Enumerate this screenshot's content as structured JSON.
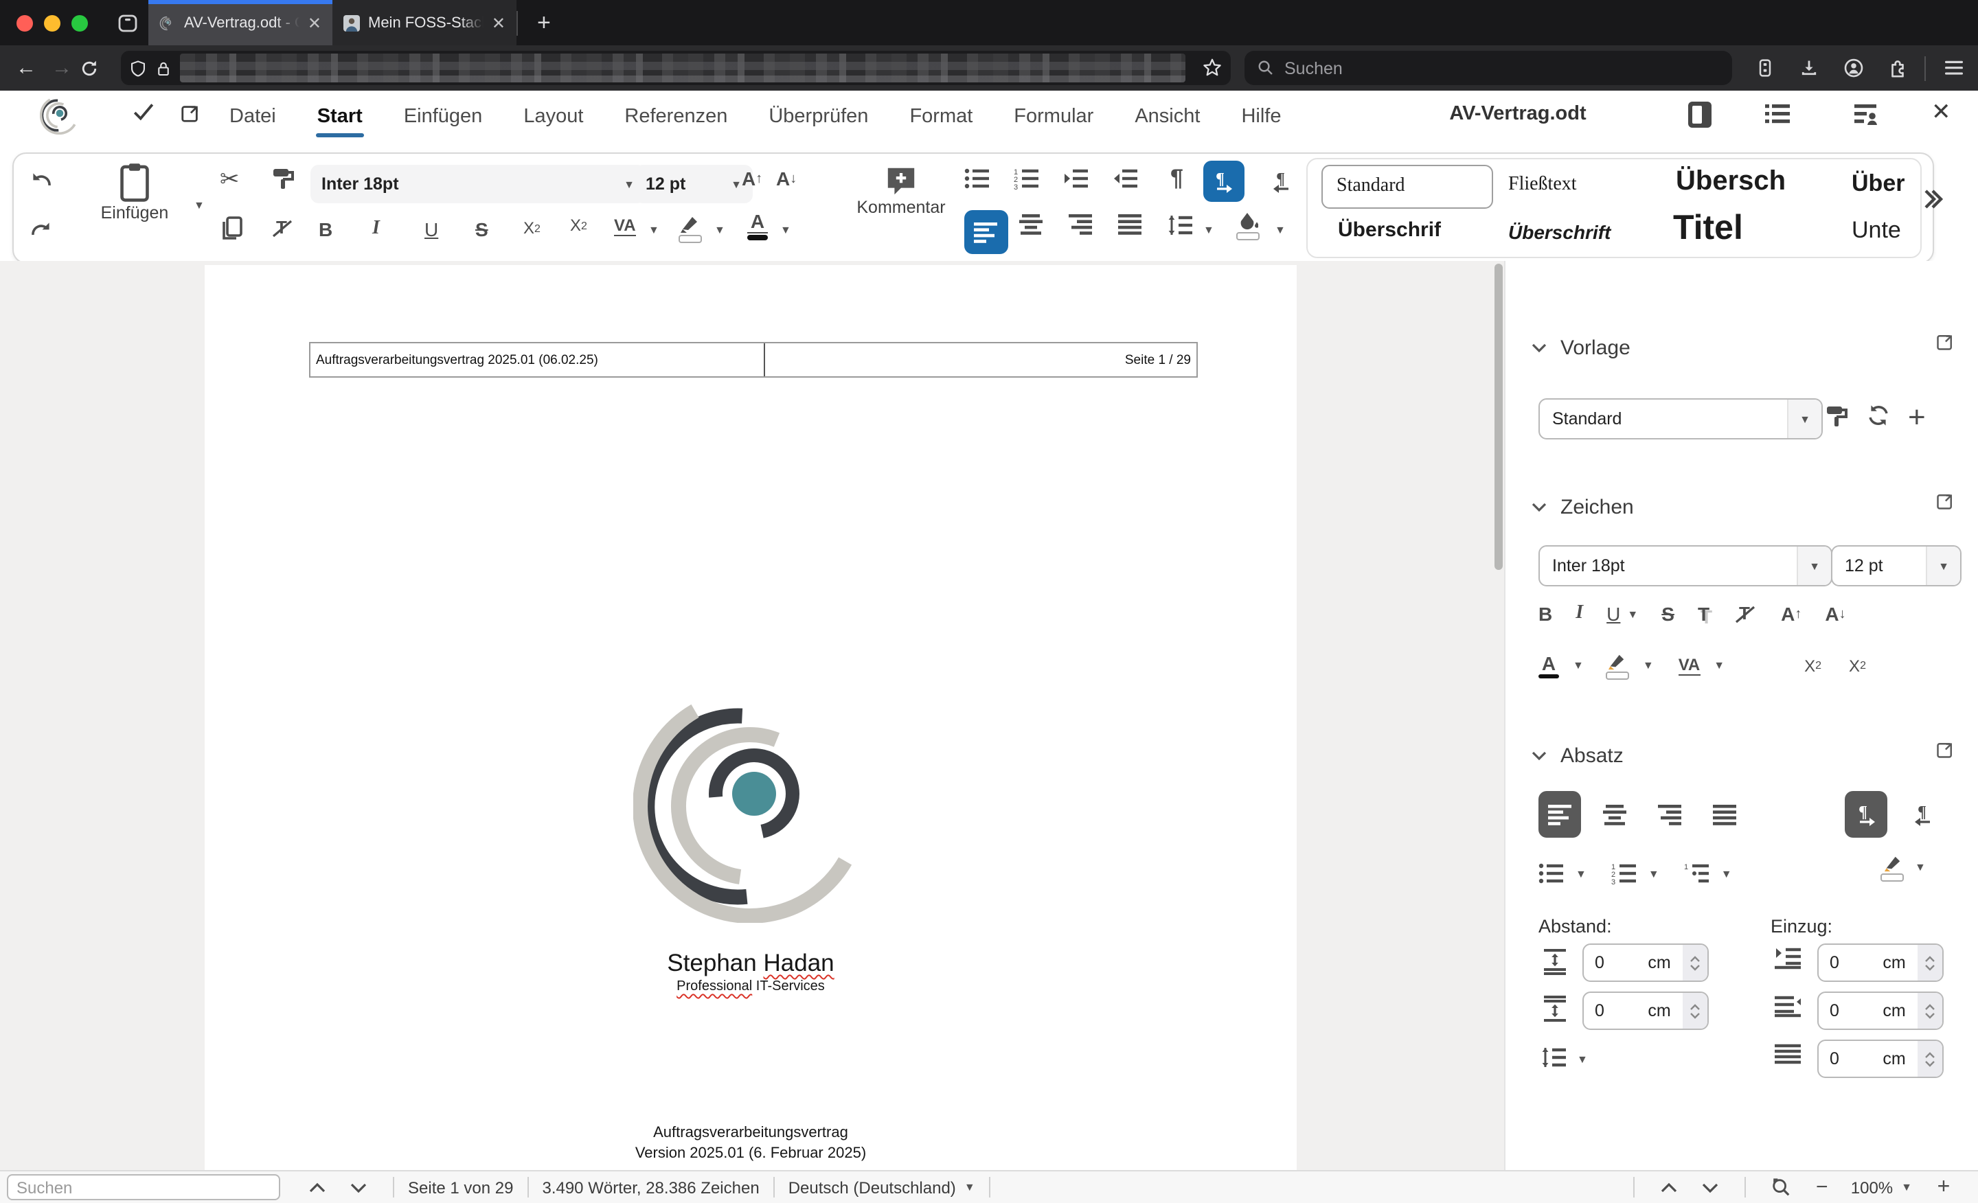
{
  "browser": {
    "tab1_title": "AV-Vertrag.odt - Office @ Hada",
    "tab2_title": "Mein FOSS-Stack - Stephan Ha",
    "search_placeholder": "Suchen"
  },
  "app": {
    "title": "AV-Vertrag.odt",
    "menus": [
      "Datei",
      "Start",
      "Einfügen",
      "Layout",
      "Referenzen",
      "Überprüfen",
      "Format",
      "Formular",
      "Ansicht",
      "Hilfe"
    ]
  },
  "ribbon": {
    "paste_label": "Einfügen",
    "font_name": "Inter 18pt",
    "font_size": "12 pt",
    "comment_label": "Kommentar",
    "styles": [
      "Standard",
      "Fließtext",
      "Übersch",
      "Über",
      "Überschrif",
      "Überschrift",
      "Titel",
      "Unte"
    ]
  },
  "doc": {
    "header_left": "Auftragsverarbeitungsvertrag 2025.01 (06.02.25)",
    "header_right": "Seite 1 / 29",
    "author": "Stephan",
    "author_name2": "Hadan",
    "subtitle_word1": "Professional",
    "subtitle_rest": " IT-Services",
    "line1": "Auftragsverarbeitungsvertrag",
    "line2": "Version 2025.01 (6. Februar 2025)"
  },
  "sidebar": {
    "vorlage": {
      "title": "Vorlage",
      "value": "Standard"
    },
    "zeichen": {
      "title": "Zeichen",
      "font_name": "Inter 18pt",
      "font_size": "12 pt"
    },
    "absatz": {
      "title": "Absatz",
      "spacing_label": "Abstand:",
      "indent_label": "Einzug:",
      "sp_above": {
        "value": "0",
        "unit": "cm"
      },
      "sp_below": {
        "value": "0",
        "unit": "cm"
      },
      "ind_before": {
        "value": "0",
        "unit": "cm"
      },
      "ind_after": {
        "value": "0",
        "unit": "cm"
      },
      "ind_first": {
        "value": "0",
        "unit": "cm"
      }
    }
  },
  "status": {
    "search_placeholder": "Suchen",
    "page": "Seite 1 von 29",
    "words": "3.490 Wörter, 28.386 Zeichen",
    "language": "Deutsch (Deutschland)",
    "zoom": "100%"
  },
  "colors": {
    "accent_blue": "#1a6cad",
    "menu_underline": "#2d6ca2",
    "tab_stripe": "#3779f0",
    "logo_teal": "#4a8e96",
    "logo_dark": "#3d4045",
    "logo_light": "#c8c6c0",
    "squiggle_red": "#d93025",
    "mac_red": "#ff5f57",
    "mac_yellow": "#febc2e",
    "mac_green": "#28c840"
  },
  "icons": {
    "search": "magnifier",
    "lock": "padlock",
    "shield": "tracking-protection",
    "star": "bookmark",
    "pilcrow": "¶"
  }
}
